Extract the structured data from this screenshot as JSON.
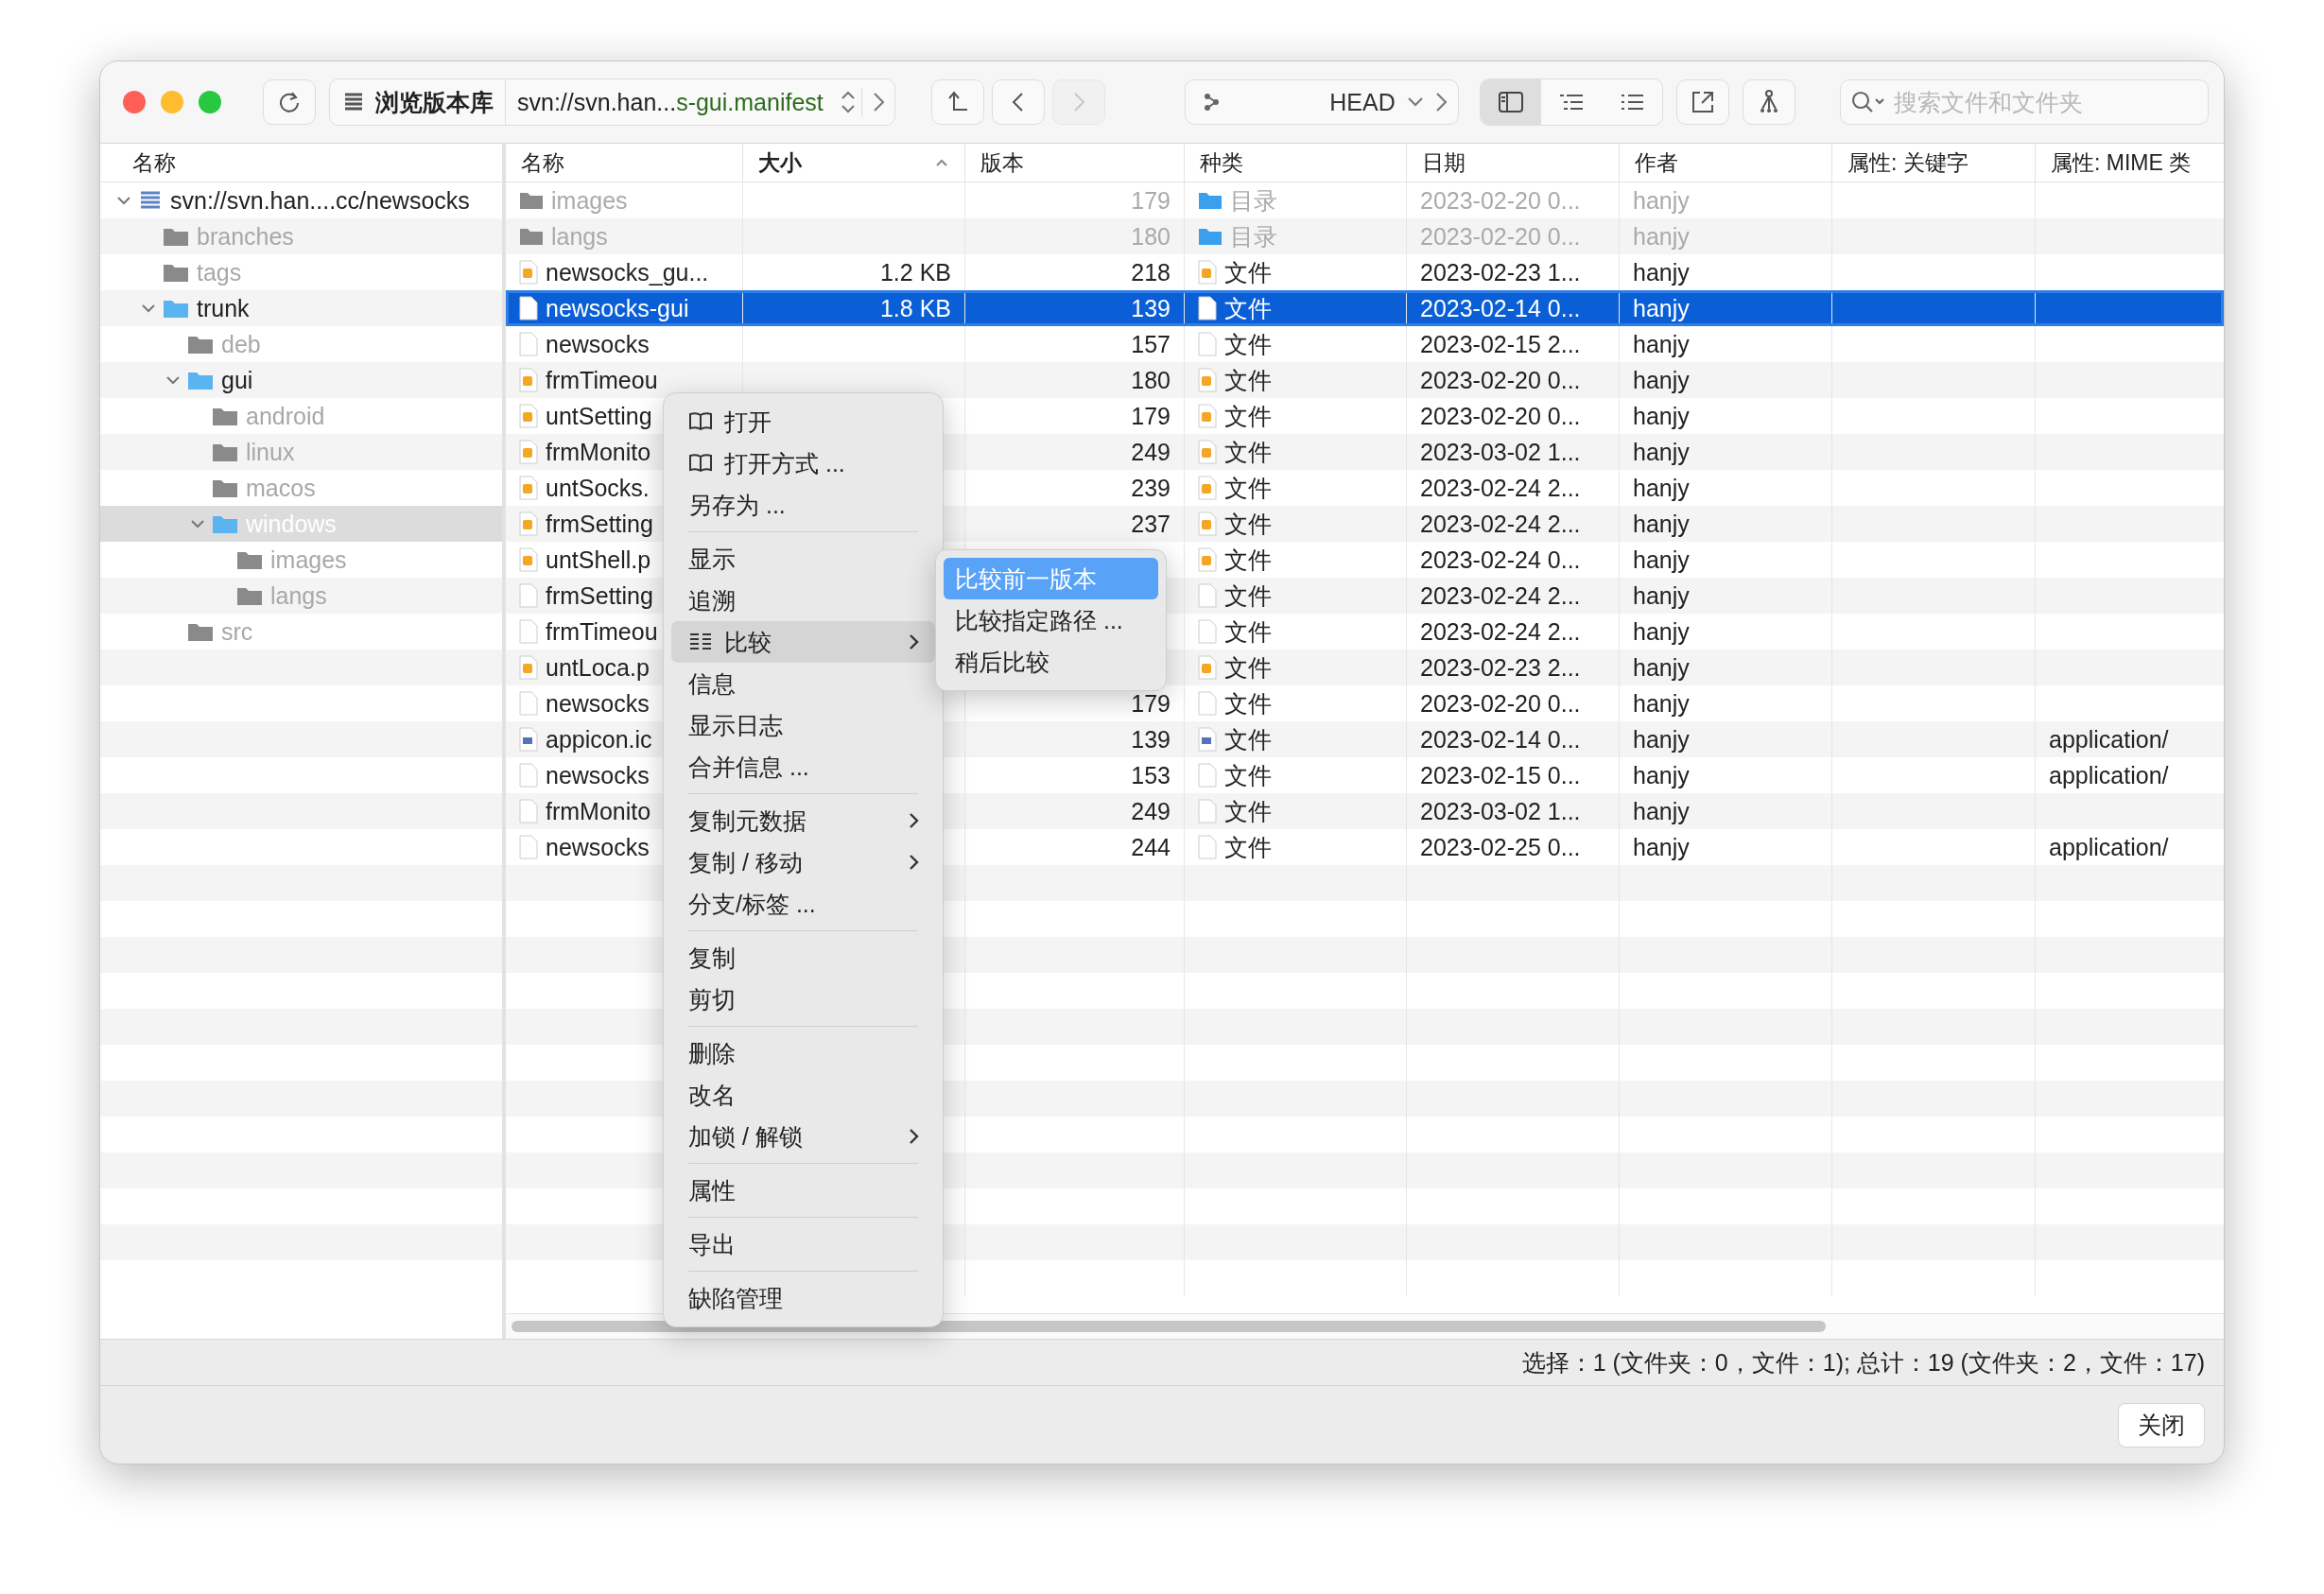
{
  "toolbar": {
    "traffic_lights": [
      {
        "kind": "close"
      },
      {
        "kind": "minimize"
      },
      {
        "kind": "zoom"
      }
    ],
    "repo_button": {
      "label": "浏览版本库"
    },
    "path": {
      "prefix": "svn://svn.han...",
      "suffix": "s-gui.manifest"
    },
    "nav_buttons": [
      {
        "kind": "up",
        "disabled": false
      },
      {
        "kind": "back",
        "disabled": false
      },
      {
        "kind": "forward",
        "disabled": true
      }
    ],
    "revision": {
      "label": "HEAD"
    },
    "view_modes": [
      {
        "kind": "sidebar",
        "selected": true
      },
      {
        "kind": "outline",
        "selected": false
      },
      {
        "kind": "list",
        "selected": false
      }
    ],
    "search": {
      "placeholder": "搜索文件和文件夹"
    }
  },
  "tree": {
    "header": "名称",
    "items": [
      {
        "label": "svn://svn.han....cc/newsocks",
        "kind": "repo",
        "dimmed": false,
        "selected": false,
        "expanded": true,
        "children": [
          {
            "label": "branches",
            "kind": "folder",
            "dimmed": true,
            "selected": false
          },
          {
            "label": "tags",
            "kind": "folder",
            "dimmed": true,
            "selected": false
          },
          {
            "label": "trunk",
            "kind": "folder",
            "dimmed": false,
            "selected": false,
            "expanded": true,
            "children": [
              {
                "label": "deb",
                "kind": "folder",
                "dimmed": true,
                "selected": false
              },
              {
                "label": "gui",
                "kind": "folder",
                "dimmed": false,
                "selected": false,
                "expanded": true,
                "children": [
                  {
                    "label": "android",
                    "kind": "folder",
                    "dimmed": true,
                    "selected": false
                  },
                  {
                    "label": "linux",
                    "kind": "folder",
                    "dimmed": true,
                    "selected": false
                  },
                  {
                    "label": "macos",
                    "kind": "folder",
                    "dimmed": true,
                    "selected": false
                  },
                  {
                    "label": "windows",
                    "kind": "folder",
                    "dimmed": false,
                    "selected": true,
                    "expanded": true,
                    "children": [
                      {
                        "label": "images",
                        "kind": "folder",
                        "dimmed": true,
                        "selected": false
                      },
                      {
                        "label": "langs",
                        "kind": "folder",
                        "dimmed": true,
                        "selected": false
                      }
                    ]
                  }
                ]
              },
              {
                "label": "src",
                "kind": "folder",
                "dimmed": true,
                "selected": false
              }
            ]
          }
        ]
      }
    ]
  },
  "table": {
    "columns": [
      {
        "label": "名称",
        "sorted": false
      },
      {
        "label": "大小",
        "sorted": true
      },
      {
        "label": "版本",
        "sorted": false
      },
      {
        "label": "种类",
        "sorted": false
      },
      {
        "label": "日期",
        "sorted": false
      },
      {
        "label": "作者",
        "sorted": false
      },
      {
        "label": "属性: 关键字",
        "sorted": false
      },
      {
        "label": "属性: MIME 类",
        "sorted": false
      }
    ],
    "rows": [
      {
        "kind": "folder",
        "name": "images",
        "revision": "179",
        "type": "目录",
        "date": "2023-02-20 0...",
        "author": "hanjy",
        "dimmed": true,
        "selected": false
      },
      {
        "kind": "folder",
        "name": "langs",
        "revision": "180",
        "type": "目录",
        "date": "2023-02-20 0...",
        "author": "hanjy",
        "dimmed": true,
        "selected": false
      },
      {
        "kind": "code",
        "name": "newsocks_gu...",
        "size": "1.2 KB",
        "revision": "218",
        "type": "文件",
        "date": "2023-02-23 1...",
        "author": "hanjy",
        "dimmed": false,
        "selected": false
      },
      {
        "kind": "blank",
        "name": "newsocks-gui",
        "size": "1.8 KB",
        "revision": "139",
        "type": "文件",
        "date": "2023-02-14 0...",
        "author": "hanjy",
        "dimmed": false,
        "selected": true
      },
      {
        "kind": "blank",
        "name": "newsocks",
        "revision": "157",
        "type": "文件",
        "date": "2023-02-15 2...",
        "author": "hanjy",
        "dimmed": false,
        "selected": false
      },
      {
        "kind": "code",
        "name": "frmTimeou",
        "revision": "180",
        "type": "文件",
        "date": "2023-02-20 0...",
        "author": "hanjy",
        "dimmed": false,
        "selected": false
      },
      {
        "kind": "code",
        "name": "untSetting",
        "revision": "179",
        "type": "文件",
        "date": "2023-02-20 0...",
        "author": "hanjy",
        "dimmed": false,
        "selected": false
      },
      {
        "kind": "code",
        "name": "frmMonito",
        "revision": "249",
        "type": "文件",
        "date": "2023-03-02 1...",
        "author": "hanjy",
        "dimmed": false,
        "selected": false
      },
      {
        "kind": "code",
        "name": "untSocks.",
        "revision": "239",
        "type": "文件",
        "date": "2023-02-24 2...",
        "author": "hanjy",
        "dimmed": false,
        "selected": false
      },
      {
        "kind": "code",
        "name": "frmSetting",
        "revision": "237",
        "type": "文件",
        "date": "2023-02-24 2...",
        "author": "hanjy",
        "dimmed": false,
        "selected": false
      },
      {
        "kind": "code",
        "name": "untShell.p",
        "type": "文件",
        "date": "2023-02-24 0...",
        "author": "hanjy",
        "dimmed": false,
        "selected": false
      },
      {
        "kind": "blank",
        "name": "frmSetting",
        "type": "文件",
        "date": "2023-02-24 2...",
        "author": "hanjy",
        "dimmed": false,
        "selected": false
      },
      {
        "kind": "blank",
        "name": "frmTimeou",
        "type": "文件",
        "date": "2023-02-24 2...",
        "author": "hanjy",
        "dimmed": false,
        "selected": false
      },
      {
        "kind": "code",
        "name": "untLoca.p",
        "type": "文件",
        "date": "2023-02-23 2...",
        "author": "hanjy",
        "dimmed": false,
        "selected": false
      },
      {
        "kind": "blank",
        "name": "newsocks",
        "revision": "179",
        "type": "文件",
        "date": "2023-02-20 0...",
        "author": "hanjy",
        "dimmed": false,
        "selected": false
      },
      {
        "kind": "image",
        "name": "appicon.ic",
        "revision": "139",
        "type": "文件",
        "date": "2023-02-14 0...",
        "author": "hanjy",
        "mime": "application/",
        "dimmed": false,
        "selected": false
      },
      {
        "kind": "blank",
        "name": "newsocks",
        "revision": "153",
        "type": "文件",
        "date": "2023-02-15 0...",
        "author": "hanjy",
        "mime": "application/",
        "dimmed": false,
        "selected": false
      },
      {
        "kind": "blank",
        "name": "frmMonito",
        "revision": "249",
        "type": "文件",
        "date": "2023-03-02 1...",
        "author": "hanjy",
        "dimmed": false,
        "selected": false
      },
      {
        "kind": "blank",
        "name": "newsocks",
        "revision": "244",
        "type": "文件",
        "date": "2023-02-25 0...",
        "author": "hanjy",
        "mime": "application/",
        "dimmed": false,
        "selected": false
      }
    ]
  },
  "context_menu": {
    "items": [
      {
        "kind": "item",
        "label": "打开",
        "submenu": false,
        "highlighted": false
      },
      {
        "kind": "item",
        "label": "打开方式 ...",
        "submenu": false,
        "highlighted": false
      },
      {
        "kind": "item",
        "label": "另存为 ...",
        "submenu": false,
        "highlighted": false
      },
      {
        "kind": "separator"
      },
      {
        "kind": "item",
        "label": "显示",
        "submenu": false,
        "highlighted": false
      },
      {
        "kind": "item",
        "label": "追溯",
        "submenu": false,
        "highlighted": false
      },
      {
        "kind": "item",
        "label": "比较",
        "submenu": true,
        "highlighted": true
      },
      {
        "kind": "item",
        "label": "信息",
        "submenu": false,
        "highlighted": false
      },
      {
        "kind": "item",
        "label": "显示日志",
        "submenu": false,
        "highlighted": false
      },
      {
        "kind": "item",
        "label": "合并信息 ...",
        "submenu": false,
        "highlighted": false
      },
      {
        "kind": "separator"
      },
      {
        "kind": "item",
        "label": "复制元数据",
        "submenu": true,
        "highlighted": false
      },
      {
        "kind": "item",
        "label": "复制 / 移动",
        "submenu": true,
        "highlighted": false
      },
      {
        "kind": "item",
        "label": "分支/标签 ...",
        "submenu": false,
        "highlighted": false
      },
      {
        "kind": "separator"
      },
      {
        "kind": "item",
        "label": "复制",
        "submenu": false,
        "highlighted": false
      },
      {
        "kind": "item",
        "label": "剪切",
        "submenu": false,
        "highlighted": false
      },
      {
        "kind": "separator"
      },
      {
        "kind": "item",
        "label": "删除",
        "submenu": false,
        "highlighted": false
      },
      {
        "kind": "item",
        "label": "改名",
        "submenu": false,
        "highlighted": false
      },
      {
        "kind": "item",
        "label": "加锁 / 解锁",
        "submenu": true,
        "highlighted": false
      },
      {
        "kind": "separator"
      },
      {
        "kind": "item",
        "label": "属性",
        "submenu": false,
        "highlighted": false
      },
      {
        "kind": "separator"
      },
      {
        "kind": "item",
        "label": "导出",
        "submenu": false,
        "highlighted": false
      },
      {
        "kind": "separator"
      },
      {
        "kind": "item",
        "label": "缺陷管理",
        "submenu": false,
        "highlighted": false
      }
    ],
    "submenu": [
      {
        "label": "比较前一版本",
        "highlighted": true
      },
      {
        "label": "比较指定路径 ...",
        "highlighted": false
      },
      {
        "label": "稍后比较",
        "highlighted": false
      }
    ]
  },
  "status_bar": {
    "text": "选择：1 (文件夹：0，文件：1); 总计：19 (文件夹：2，文件：17)"
  },
  "footer": {
    "close_button": "关闭"
  }
}
